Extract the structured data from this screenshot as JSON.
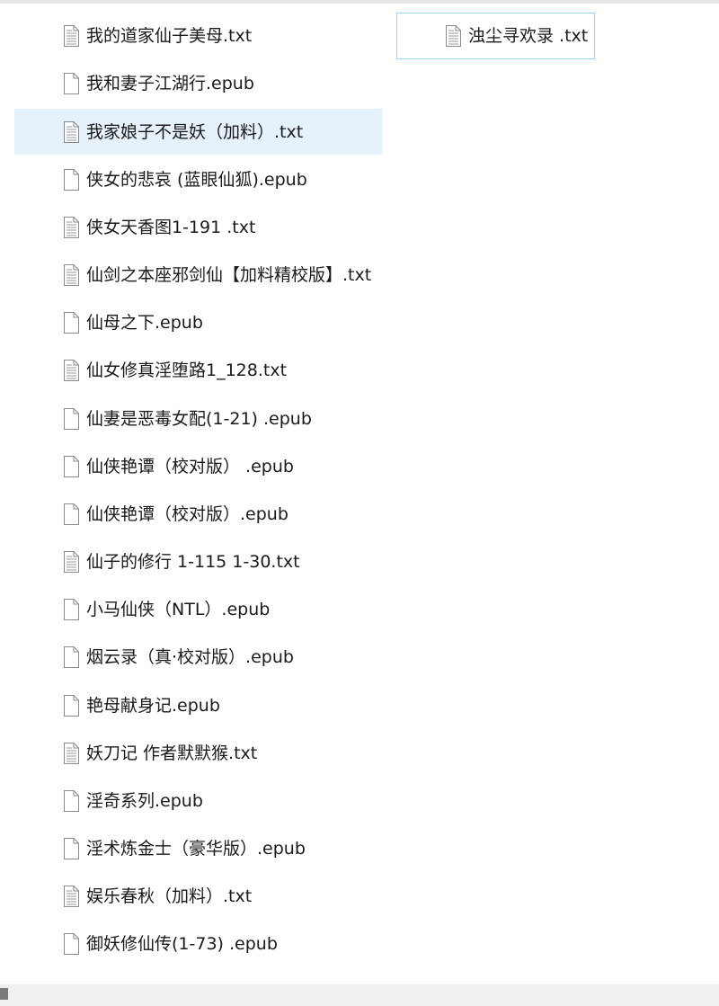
{
  "files": [
    {
      "name": "我的道家仙子美母.txt",
      "icon": "text-file-icon"
    },
    {
      "name": "我和妻子江湖行.epub",
      "icon": "blank-file-icon"
    },
    {
      "name": "我家娘子不是妖（加料）.txt",
      "icon": "text-file-icon"
    },
    {
      "name": "侠女的悲哀 (蓝眼仙狐).epub",
      "icon": "blank-file-icon"
    },
    {
      "name": "侠女天香图1-191 .txt",
      "icon": "text-file-icon"
    },
    {
      "name": "仙剑之本座邪剑仙【加料精校版】.txt",
      "icon": "text-file-icon"
    },
    {
      "name": "仙母之下.epub",
      "icon": "blank-file-icon"
    },
    {
      "name": "仙女修真淫堕路1_128.txt",
      "icon": "text-file-icon"
    },
    {
      "name": "仙妻是恶毒女配(1-21) .epub",
      "icon": "blank-file-icon"
    },
    {
      "name": "仙侠艳谭（校对版） .epub",
      "icon": "blank-file-icon"
    },
    {
      "name": "仙侠艳谭（校对版）.epub",
      "icon": "blank-file-icon"
    },
    {
      "name": "仙子的修行 1-115 1-30.txt",
      "icon": "text-file-icon"
    },
    {
      "name": "小马仙侠（NTL）.epub",
      "icon": "blank-file-icon"
    },
    {
      "name": "烟云录（真·校对版）.epub",
      "icon": "blank-file-icon"
    },
    {
      "name": "艳母献身记.epub",
      "icon": "blank-file-icon"
    },
    {
      "name": "妖刀记 作者默默猴.txt",
      "icon": "text-file-icon"
    },
    {
      "name": "淫奇系列.epub",
      "icon": "blank-file-icon"
    },
    {
      "name": "淫术炼金士（豪华版）.epub",
      "icon": "blank-file-icon"
    },
    {
      "name": "娱乐春秋（加料）.txt",
      "icon": "text-file-icon"
    },
    {
      "name": "御妖修仙传(1-73) .epub",
      "icon": "blank-file-icon"
    }
  ],
  "focused_file": {
    "name": "浊尘寻欢录 .txt",
    "icon": "text-file-icon"
  },
  "colors": {
    "selected_background": "#e5f1fb",
    "focus_border": "#99d1ff",
    "text": "#1a1a1a"
  }
}
